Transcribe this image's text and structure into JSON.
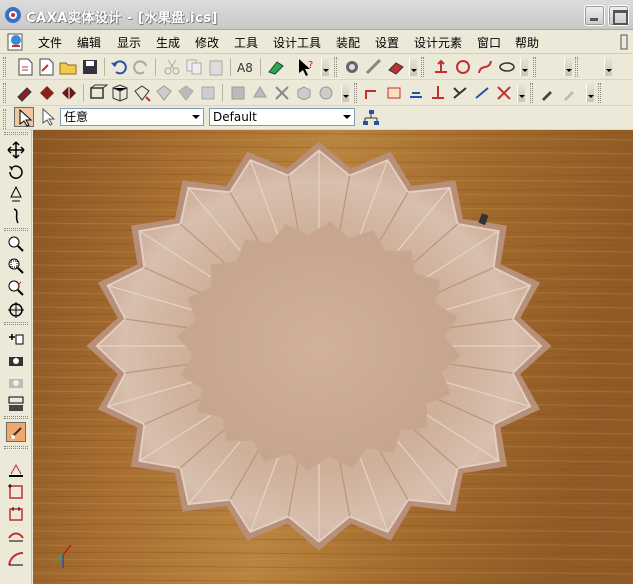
{
  "window": {
    "title": "CAXA实体设计 - [水果盘.ics]"
  },
  "menu": {
    "items": [
      "文件",
      "编辑",
      "显示",
      "生成",
      "修改",
      "工具",
      "设计工具",
      "装配",
      "设置",
      "设计元素",
      "窗口",
      "帮助"
    ]
  },
  "selection_bar": {
    "filter_value": "任意",
    "style_value": "Default"
  },
  "icons": {
    "app": "caxa-app-icon",
    "doc": "document-icon"
  },
  "colors": {
    "titlebar": "#c8c8c8",
    "chrome": "#ece9d8",
    "wood": "#a9722f",
    "bowl": "#d6b9a4",
    "active_tool": "#f0a86b"
  }
}
